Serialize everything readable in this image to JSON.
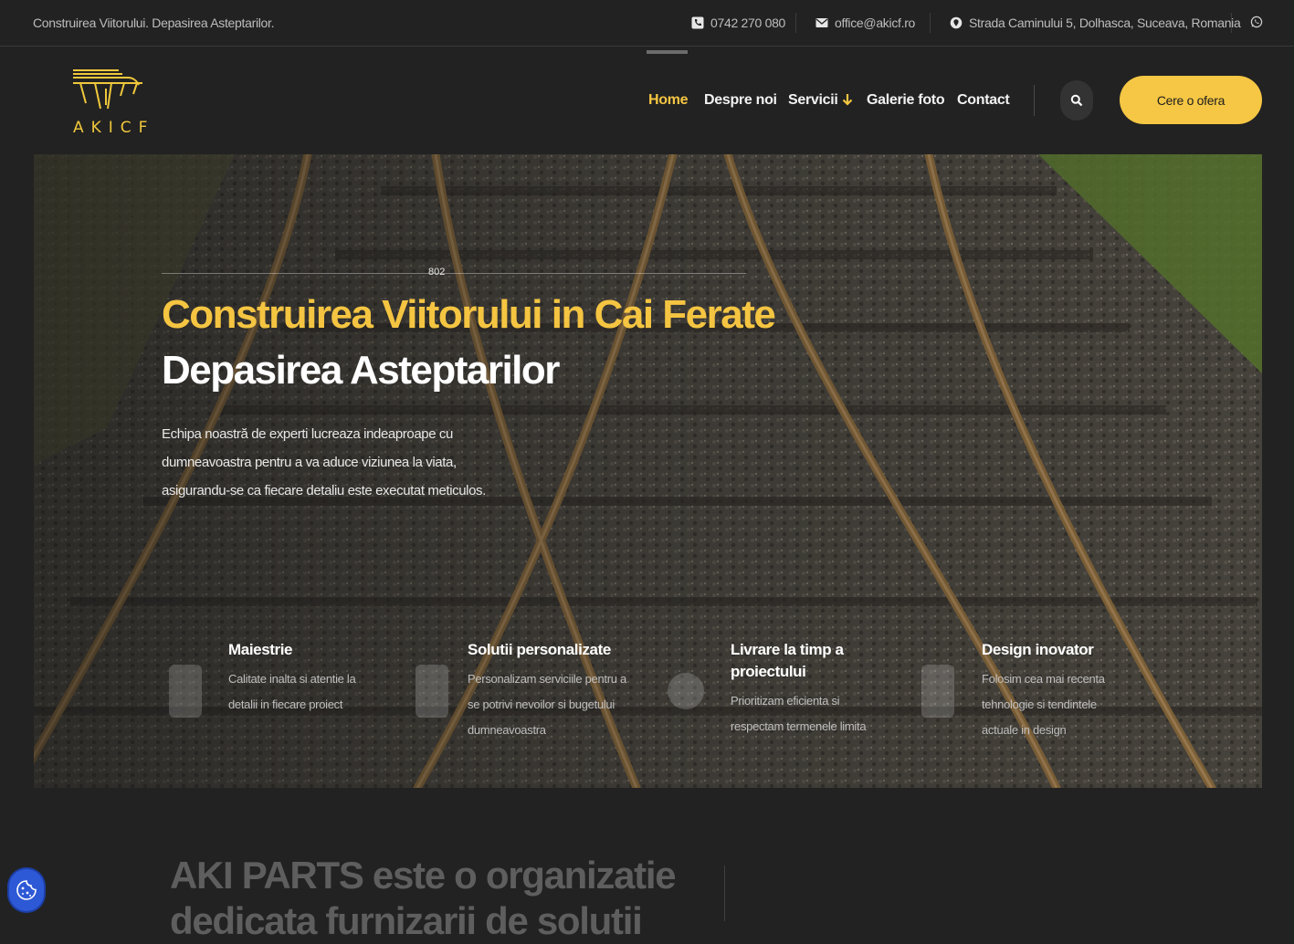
{
  "topbar": {
    "tagline": "Construirea Viitorului. Depasirea Asteptarilor.",
    "phone": "0742 270 080",
    "email": "office@akicf.ro",
    "address": "Strada Caminului 5, Dolhasca, Suceava, Romania",
    "icons": [
      "phone-icon",
      "mail-icon",
      "location-icon",
      "whatsapp-icon"
    ]
  },
  "brand": {
    "logo_text": "AKICF"
  },
  "nav": {
    "items": [
      {
        "label": "Home",
        "active": true
      },
      {
        "label": "Despre noi"
      },
      {
        "label": "Servicii"
      },
      {
        "label": "Galerie foto"
      },
      {
        "label": "Contact"
      }
    ],
    "cta": "Cere o ofera"
  },
  "hero": {
    "number": "802",
    "title": "Construirea Viitorului in Cai Ferate",
    "subtitle": "Depasirea Asteptarilor",
    "description": "Echipa noastră de experti lucreaza indeaproape cu dumneavoastra pentru a va aduce viziunea la viata, asigurandu-se ca fiecare detaliu este executat meticulos."
  },
  "features": [
    {
      "title": "Maiestrie",
      "desc": "Calitate inalta si atentie la detalii in fiecare proiect"
    },
    {
      "title": "Solutii personalizate",
      "desc": "Personalizam serviciile pentru a se potrivi nevoilor si bugetului dumneavoastra"
    },
    {
      "title": "Livrare la timp a proiectului",
      "desc": "Prioritizam eficienta si respectam termenele limita"
    },
    {
      "title": "Design inovator",
      "desc": "Folosim cea mai recenta tehnologie si tendintele actuale in design"
    }
  ],
  "lower": {
    "title": "AKI PARTS este o organizatie dedicata furnizarii de solutii"
  },
  "colors": {
    "accent": "#f5c542",
    "background": "#222222",
    "cta": "#f6c744"
  }
}
